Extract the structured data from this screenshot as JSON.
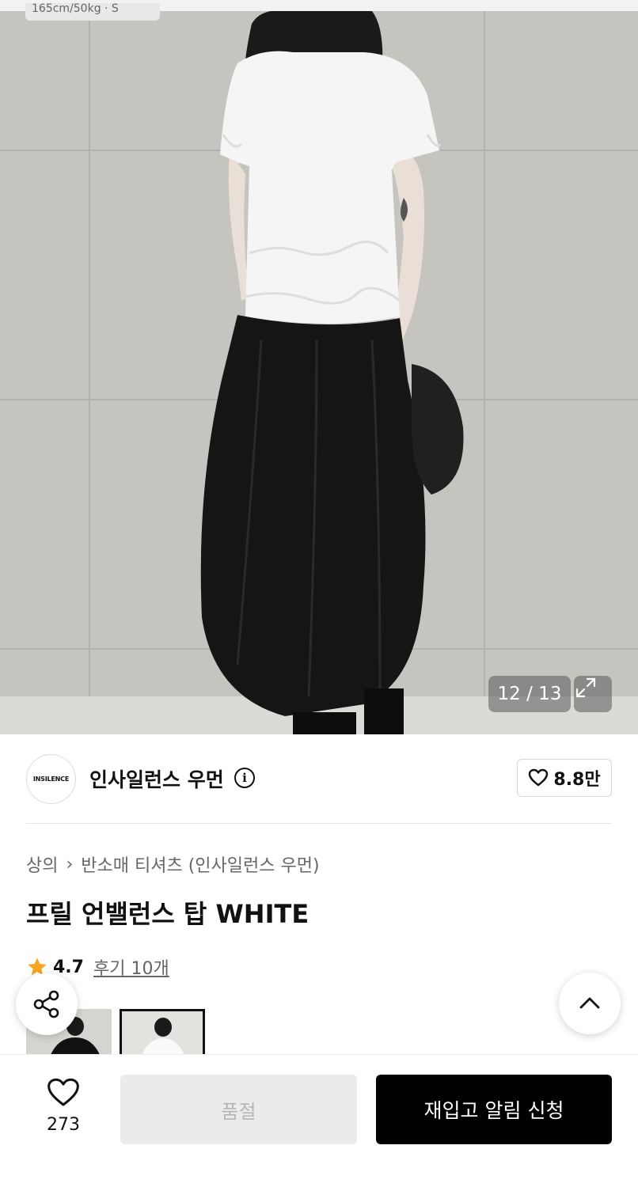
{
  "gallery": {
    "caption": "165cm/50kg · S",
    "counter": "12 / 13",
    "expand_icon": "expand-icon"
  },
  "brand": {
    "logo_text": "INSILENCE",
    "name": "인사일런스 우먼",
    "info_icon": "i",
    "likes": "8.8만"
  },
  "product": {
    "breadcrumb": [
      "상의",
      "반소매 티셔츠 (인사일런스 우먼)"
    ],
    "title": "프릴 언밸런스 탑 WHITE",
    "rating": "4.7",
    "reviews": "후기 10개"
  },
  "bottom": {
    "wish_count": "273",
    "soldout_label": "품절",
    "restock_label": "재입고 알림 신청"
  },
  "colors": {
    "accent_star": "#f5a623",
    "primary_button": "#000000",
    "disabled_button": "#ebebeb"
  }
}
